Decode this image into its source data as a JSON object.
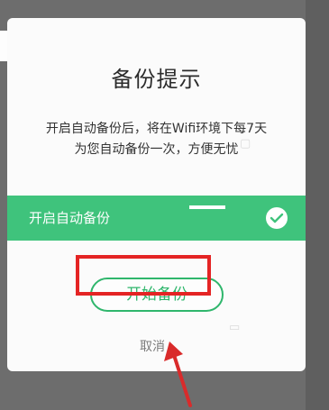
{
  "dialog": {
    "title": "备份提示",
    "message_line1": "开启自动备份后，将在Wifi环境下每7天",
    "message_line2": "为您自动备份一次，方便无忧",
    "toggle_label": "开启自动备份",
    "primary_button": "开始备份",
    "cancel_button": "取消"
  },
  "colors": {
    "overlay": "#6d6d6d",
    "dialog_background": "#fbfbfb",
    "accent_green": "#3fc37c",
    "button_border": "#2fb66c",
    "highlight_red": "#e42424"
  },
  "icons": {
    "toggle": "checkmark-circle-icon",
    "annotation": "red-arrow-icon"
  }
}
